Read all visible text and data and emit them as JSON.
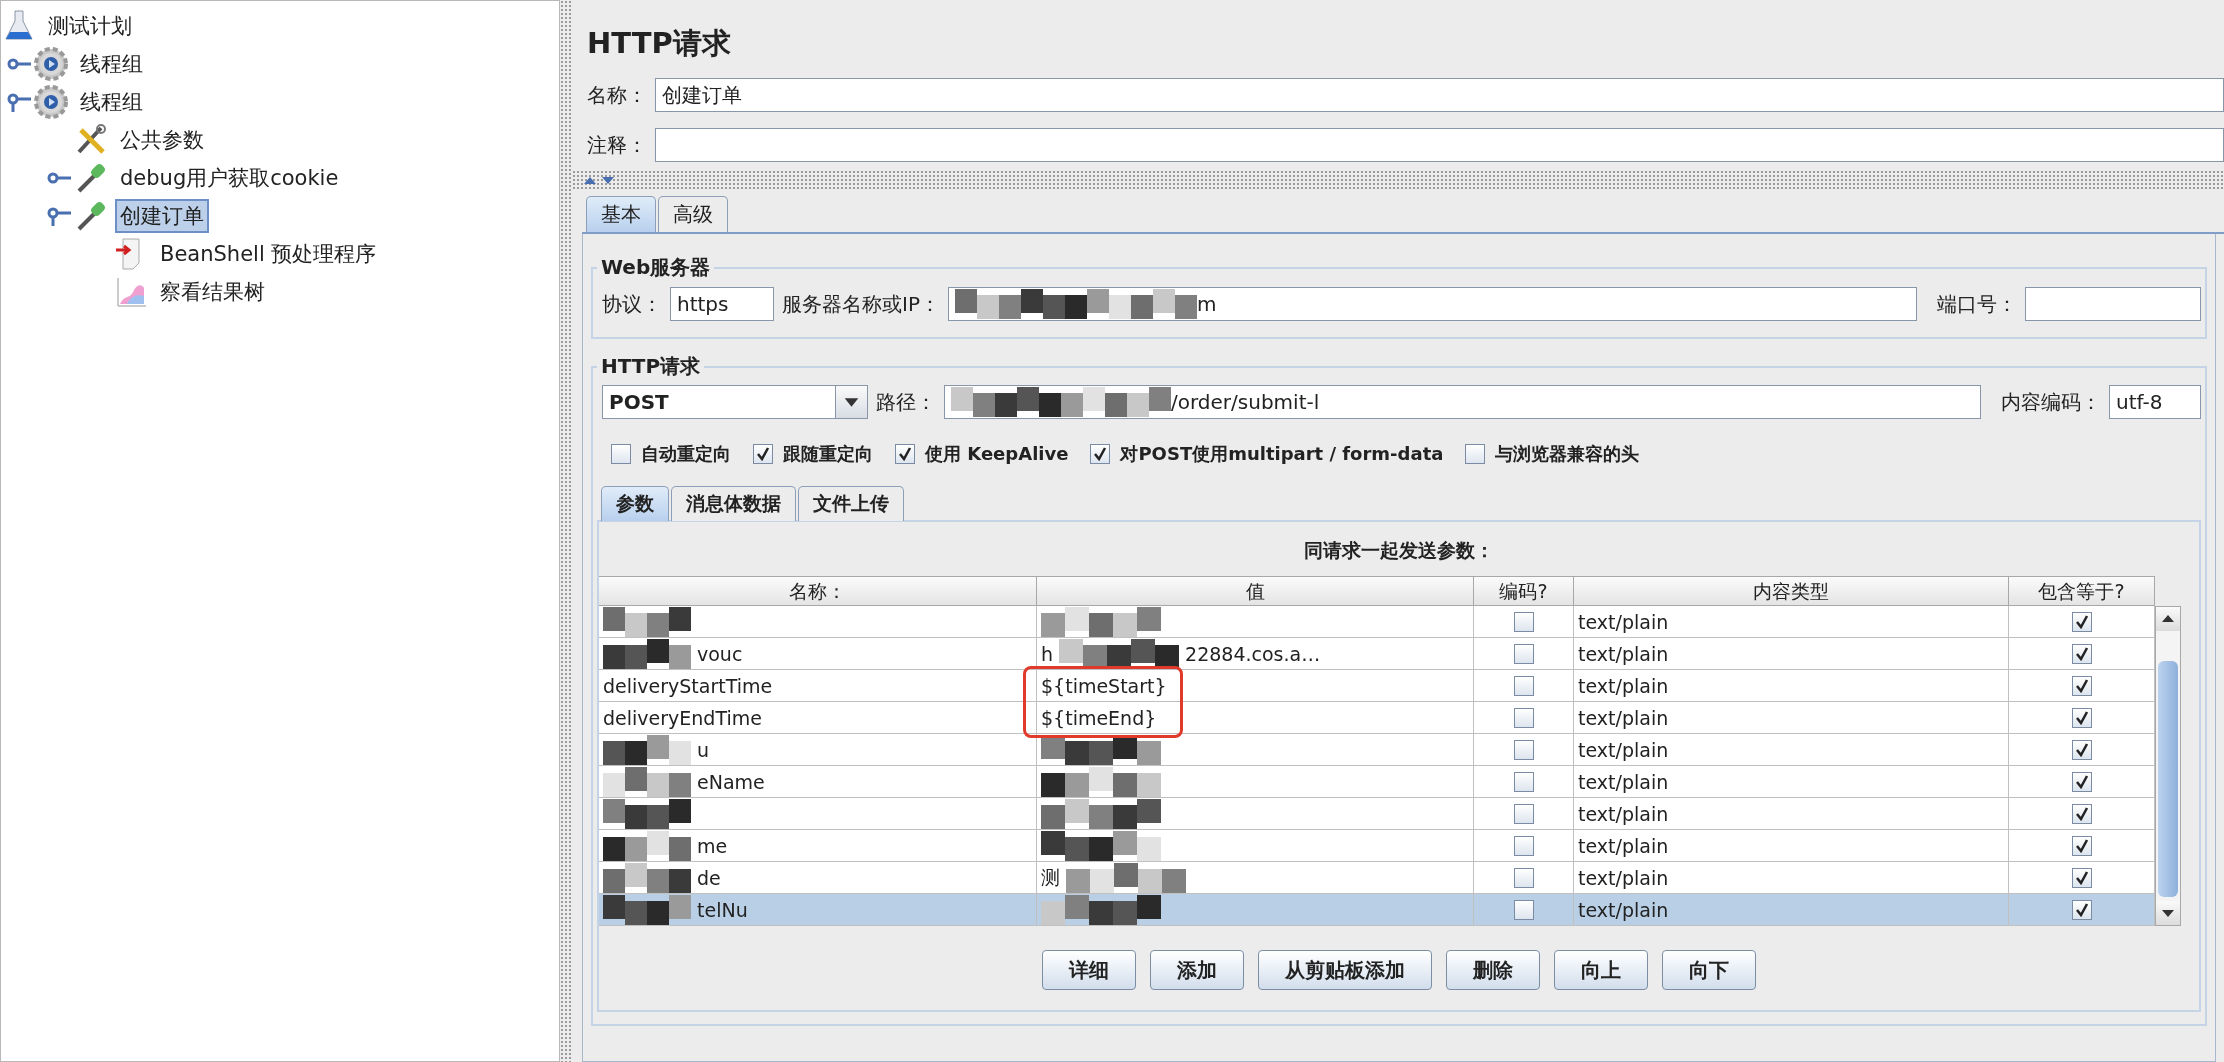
{
  "tree": [
    {
      "label": "测试计划",
      "kind": "plan",
      "selected": false,
      "children": [
        {
          "label": "线程组",
          "kind": "thread-group",
          "selected": false,
          "expanded": false
        },
        {
          "label": "线程组",
          "kind": "thread-group",
          "selected": false,
          "expanded": true,
          "children": [
            {
              "label": "公共参数",
              "kind": "config",
              "selected": false
            },
            {
              "label": "debug用户获取cookie",
              "kind": "sampler",
              "selected": false,
              "expanded": false
            },
            {
              "label": "创建订单",
              "kind": "sampler",
              "selected": true,
              "expanded": true,
              "children": [
                {
                  "label": "BeanShell 预处理程序",
                  "kind": "preprocessor",
                  "selected": false
                },
                {
                  "label": "察看结果树",
                  "kind": "listener",
                  "selected": false
                }
              ]
            }
          ]
        }
      ]
    }
  ],
  "panel": {
    "title": "HTTP请求",
    "name": {
      "label": "名称：",
      "value": "创建订单"
    },
    "comment": {
      "label": "注释："
    },
    "tabs": [
      {
        "label": "基本",
        "selected": true
      },
      {
        "label": "高级",
        "selected": false
      }
    ],
    "web_server": {
      "legend": "Web服务器",
      "protocol_label": "协议：",
      "protocol": "https",
      "server_label": "服务器名称或IP：",
      "server": "m",
      "server_redacted": true,
      "port_label": "端口号："
    },
    "http_request": {
      "legend": "HTTP请求",
      "method": "POST",
      "path_label": "路径：",
      "path": "/order/submit-l",
      "path_redacted": true,
      "encoding_label": "内容编码：",
      "encoding": "utf-8",
      "options": [
        {
          "label": "自动重定向",
          "checked": false
        },
        {
          "label": "跟随重定向",
          "checked": true
        },
        {
          "label": "使用 KeepAlive",
          "checked": true
        },
        {
          "label": "对POST使用multipart / form-data",
          "checked": true
        },
        {
          "label": "与浏览器兼容的头",
          "checked": false
        }
      ]
    },
    "sub_tabs": [
      {
        "label": "参数",
        "selected": true
      },
      {
        "label": "消息体数据",
        "selected": false
      },
      {
        "label": "文件上传",
        "selected": false
      }
    ],
    "table": {
      "caption": "同请求一起发送参数：",
      "columns": [
        "名称：",
        "值",
        "编码?",
        "内容类型",
        "包含等于?"
      ],
      "rows": [
        {
          "name": "",
          "value": "",
          "redacted": true,
          "encode": false,
          "content_type": "text/plain",
          "include_equals": true,
          "selected": false,
          "highlighted": false
        },
        {
          "name": "vouc",
          "value": "h",
          "value_tail": "22884.cos.a…",
          "redacted": true,
          "encode": false,
          "content_type": "text/plain",
          "include_equals": true,
          "selected": false,
          "highlighted": false
        },
        {
          "name": "deliveryStartTime",
          "value": "${timeStart}",
          "redacted": false,
          "encode": false,
          "content_type": "text/plain",
          "include_equals": true,
          "selected": false,
          "highlighted": true
        },
        {
          "name": "deliveryEndTime",
          "value": "${timeEnd}",
          "redacted": false,
          "encode": false,
          "content_type": "text/plain",
          "include_equals": true,
          "selected": false,
          "highlighted": true
        },
        {
          "name": "u",
          "value": "",
          "redacted": true,
          "encode": false,
          "content_type": "text/plain",
          "include_equals": true,
          "selected": false,
          "highlighted": false
        },
        {
          "name": "eName",
          "value": "",
          "redacted": true,
          "encode": false,
          "content_type": "text/plain",
          "include_equals": true,
          "selected": false,
          "highlighted": false
        },
        {
          "name": "",
          "value": "",
          "redacted": true,
          "encode": false,
          "content_type": "text/plain",
          "include_equals": true,
          "selected": false,
          "highlighted": false
        },
        {
          "name": "me",
          "value": "",
          "redacted": true,
          "encode": false,
          "content_type": "text/plain",
          "include_equals": true,
          "selected": false,
          "highlighted": false
        },
        {
          "name": "de",
          "value": "测",
          "redacted": true,
          "encode": false,
          "content_type": "text/plain",
          "include_equals": true,
          "selected": false,
          "highlighted": false
        },
        {
          "name": "telNu",
          "value": "",
          "redacted": true,
          "encode": false,
          "content_type": "text/plain",
          "include_equals": true,
          "selected": true,
          "highlighted": false
        }
      ]
    },
    "buttons": [
      "详细",
      "添加",
      "从剪贴板添加",
      "删除",
      "向上",
      "向下"
    ]
  }
}
